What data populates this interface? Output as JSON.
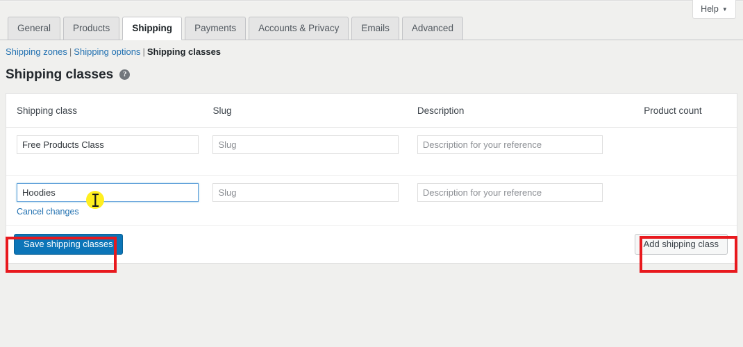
{
  "help_tab": {
    "label": "Help",
    "caret": "▼"
  },
  "tabs": [
    {
      "label": "General",
      "active": false
    },
    {
      "label": "Products",
      "active": false
    },
    {
      "label": "Shipping",
      "active": true
    },
    {
      "label": "Payments",
      "active": false
    },
    {
      "label": "Accounts & Privacy",
      "active": false
    },
    {
      "label": "Emails",
      "active": false
    },
    {
      "label": "Advanced",
      "active": false
    }
  ],
  "subnav": {
    "links": [
      {
        "label": "Shipping zones",
        "current": false
      },
      {
        "label": "Shipping options",
        "current": false
      },
      {
        "label": "Shipping classes",
        "current": true
      }
    ],
    "separator": "|"
  },
  "page": {
    "title": "Shipping classes",
    "help_icon_glyph": "?"
  },
  "table": {
    "columns": [
      "Shipping class",
      "Slug",
      "Description",
      "Product count"
    ],
    "rows": [
      {
        "name_value": "Free Products Class",
        "name_placeholder": "",
        "slug_value": "",
        "slug_placeholder": "Slug",
        "description_value": "",
        "description_placeholder": "Description for your reference",
        "product_count": "",
        "focused": false,
        "cancel_label": ""
      },
      {
        "name_value": "Hoodies",
        "name_placeholder": "",
        "slug_value": "",
        "slug_placeholder": "Slug",
        "description_value": "",
        "description_placeholder": "Description for your reference",
        "product_count": "",
        "focused": true,
        "cancel_label": "Cancel changes"
      }
    ]
  },
  "actions": {
    "save_label": "Save shipping classes",
    "add_label": "Add shipping class"
  },
  "colors": {
    "primary_button": "#0c75b8",
    "link": "#2271b1",
    "annotation": "#e8191e",
    "cursor_highlight": "#ffef20",
    "focus_border": "#5b9dd9",
    "page_background": "#f0f0ee"
  }
}
